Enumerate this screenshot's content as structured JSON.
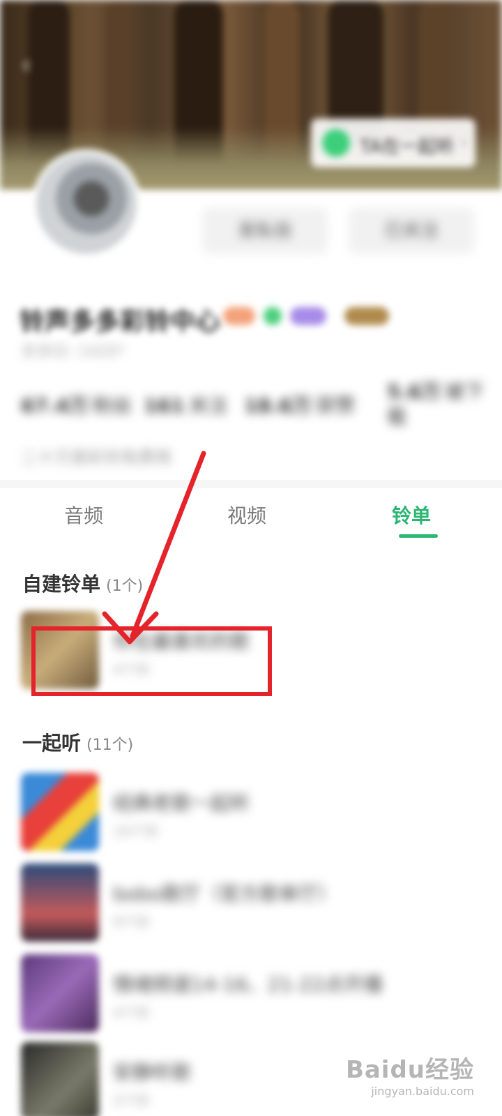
{
  "header": {
    "listen_together_label": "TA在一起听",
    "follow_button_label": "发私信",
    "followed_button_label": "已关注"
  },
  "profile": {
    "name": "铃声多多彩铃中心",
    "user_id": "多多ID: 1420*",
    "stats": [
      {
        "value": "67.4万",
        "label": "粉丝"
      },
      {
        "value": "161",
        "label": "关注"
      },
      {
        "value": "18.6万",
        "label": "获赞"
      },
      {
        "value": "5.6万",
        "label": "被下载"
      }
    ],
    "bio": "二十万首彩铃免费用"
  },
  "tabs": [
    {
      "label": "音频",
      "active": false
    },
    {
      "label": "视频",
      "active": false
    },
    {
      "label": "铃单",
      "active": true
    }
  ],
  "sections": [
    {
      "title": "自建铃单",
      "count": "(1个)",
      "items": [
        {
          "title": "你在最喜欢的歌",
          "sub": "4个铃"
        }
      ]
    },
    {
      "title": "一起听",
      "count": "(11个)",
      "items": [
        {
          "title": "经典老歌一起听",
          "sub": "10个铃"
        },
        {
          "title": "bobo歌厅（官方歌单厅）",
          "sub": "9个铃"
        },
        {
          "title": "情绪频道14-16、21-22点开播",
          "sub": "4个铃"
        },
        {
          "title": "安静听歌",
          "sub": "3个铃"
        }
      ]
    }
  ],
  "watermark": {
    "brand": "Baidu经验",
    "url": "jingyan.baidu.com"
  },
  "colors": {
    "accent": "#2bb673",
    "annotation": "#e5232b"
  }
}
